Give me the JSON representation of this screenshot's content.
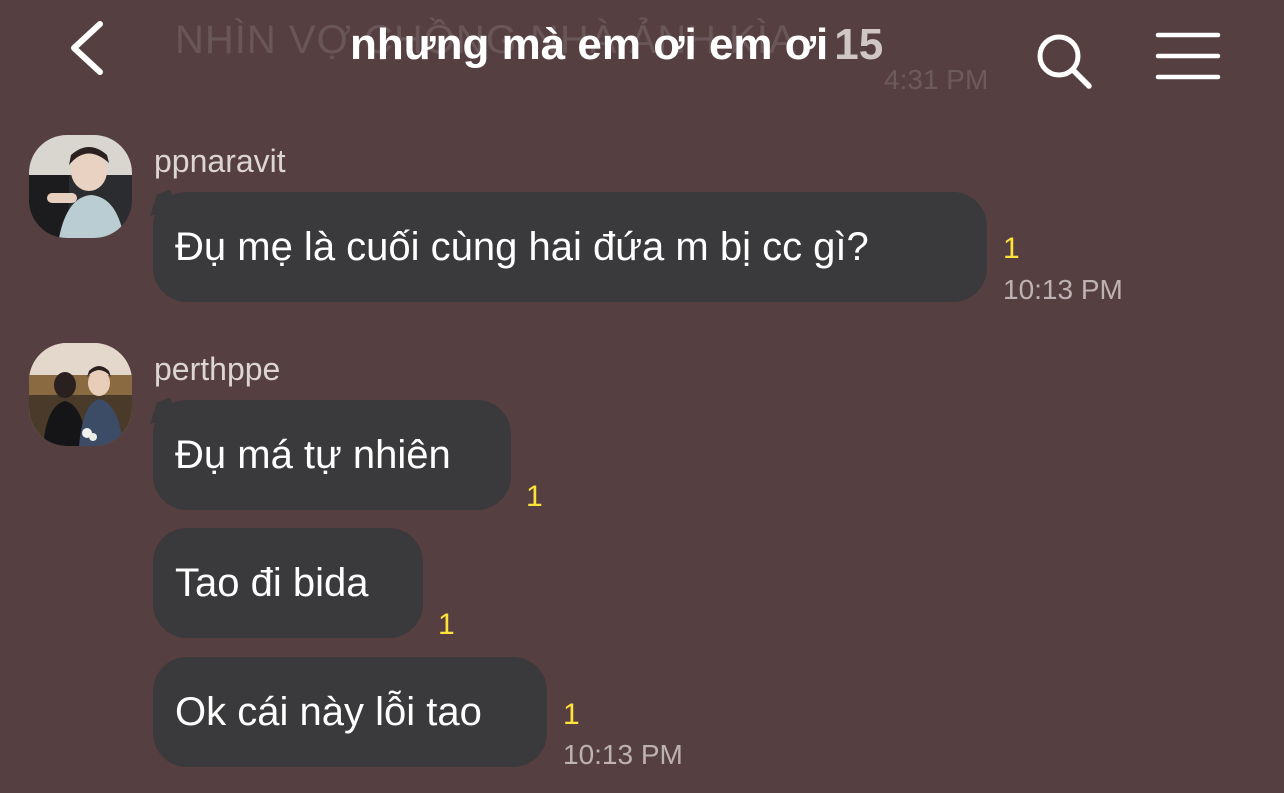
{
  "background_color": "#553f41",
  "header": {
    "ghost_title": "NHÌN VỢ CHỒNG NHÀ ẢNH KÌA",
    "ghost_time": "4:31 PM",
    "back_icon": "chevron-left-icon",
    "title": "nhưng mà em ơi em ơi",
    "member_count": "15",
    "search_icon": "search-icon",
    "menu_icon": "hamburger-menu-icon"
  },
  "messages": [
    {
      "sender": "ppnaravit",
      "avatar": "avatar-ppnaravit",
      "bubbles": [
        {
          "text": "Đụ mẹ là cuối cùng hai đứa m bị cc gì?",
          "unread": "1",
          "time": "10:13 PM"
        }
      ]
    },
    {
      "sender": "perthppe",
      "avatar": "avatar-perthppe",
      "bubbles": [
        {
          "text": "Đụ má tự nhiên",
          "unread": "1",
          "time": ""
        },
        {
          "text": "Tao đi bida",
          "unread": "1",
          "time": ""
        },
        {
          "text": "Ok cái này lỗi tao",
          "unread": "1",
          "time": "10:13 PM"
        }
      ]
    }
  ],
  "colors": {
    "bubble": "#3a393b",
    "unread": "#ffe23a",
    "timestamp": "#bdb2b3"
  }
}
